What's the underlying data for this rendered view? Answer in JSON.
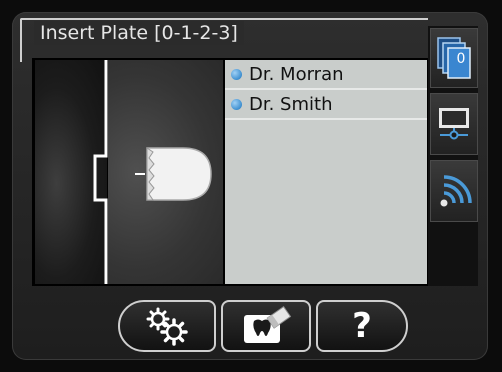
{
  "header": {
    "title": "Insert Plate [0-1-2-3]"
  },
  "patients": [
    {
      "name": "Dr. Morran"
    },
    {
      "name": "Dr. Smith"
    }
  ],
  "sidebar": {
    "plates_count": "0",
    "buttons": [
      {
        "icon": "plates-stack-icon"
      },
      {
        "icon": "network-monitor-icon"
      },
      {
        "icon": "wifi-signal-icon"
      }
    ]
  },
  "toolbar": {
    "buttons": [
      {
        "icon": "settings-gears-icon"
      },
      {
        "icon": "scan-tooth-eraser-icon"
      },
      {
        "icon": "help-icon",
        "label": "?"
      }
    ]
  },
  "colors": {
    "accent_blue": "#3e8fd0",
    "list_background": "#c9cdcb",
    "frame_border": "#cfcfcf"
  }
}
